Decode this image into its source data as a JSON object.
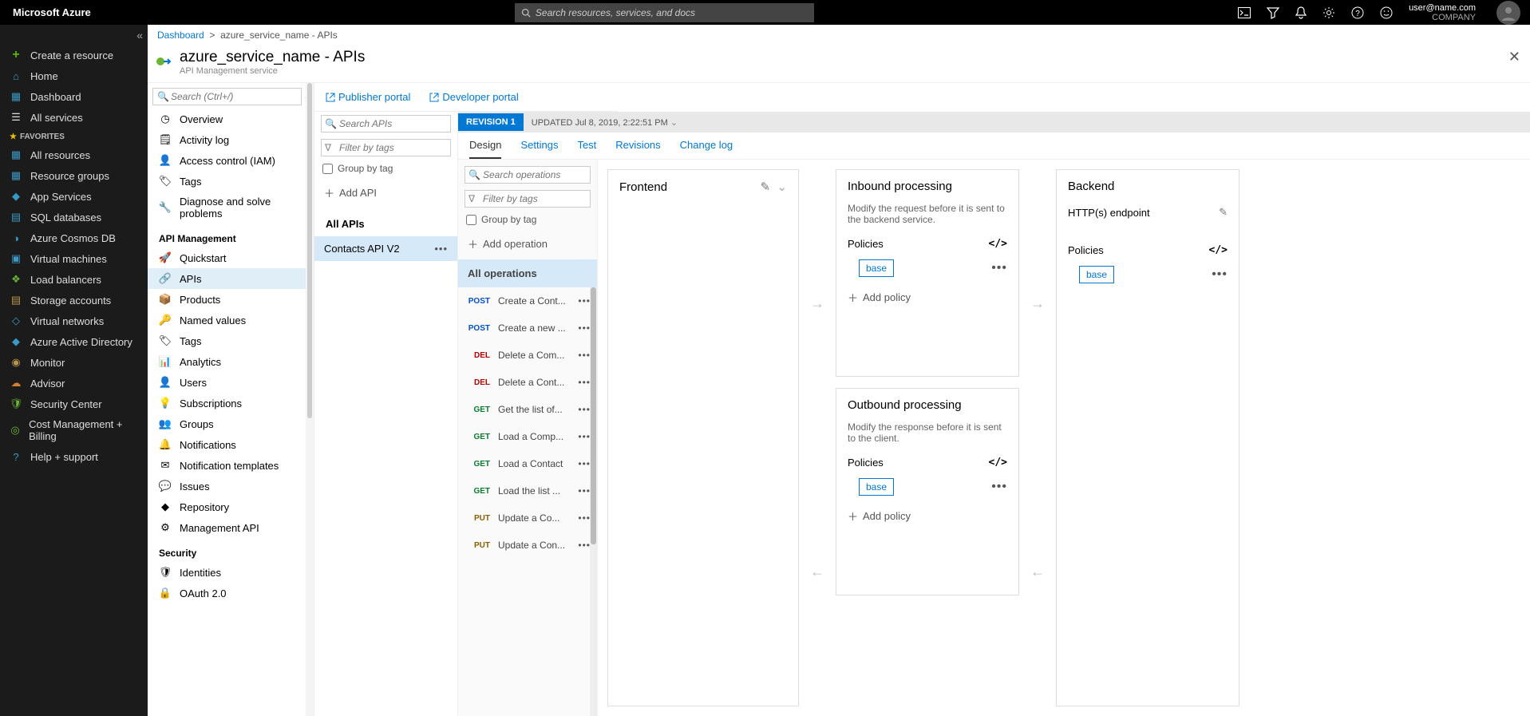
{
  "topbar": {
    "brand": "Microsoft Azure",
    "search_placeholder": "Search resources, services, and docs",
    "user_email": "user@name.com",
    "user_company": "COMPANY"
  },
  "leftnav": {
    "create": "Create a resource",
    "home": "Home",
    "dashboard": "Dashboard",
    "all_services": "All services",
    "favorites_label": "FAVORITES",
    "items": [
      "All resources",
      "Resource groups",
      "App Services",
      "SQL databases",
      "Azure Cosmos DB",
      "Virtual machines",
      "Load balancers",
      "Storage accounts",
      "Virtual networks",
      "Azure Active Directory",
      "Monitor",
      "Advisor",
      "Security Center",
      "Cost Management + Billing",
      "Help + support"
    ]
  },
  "breadcrumb": {
    "root": "Dashboard",
    "current": "azure_service_name - APIs"
  },
  "page": {
    "title": "azure_service_name - APIs",
    "subtitle": "API Management service"
  },
  "blade": {
    "search_placeholder": "Search (Ctrl+/)",
    "top_items": [
      "Overview",
      "Activity log",
      "Access control (IAM)",
      "Tags",
      "Diagnose and solve problems"
    ],
    "section1": "API Management",
    "mgmt_items": [
      "Quickstart",
      "APIs",
      "Products",
      "Named values",
      "Tags",
      "Analytics",
      "Users",
      "Subscriptions",
      "Groups",
      "Notifications",
      "Notification templates",
      "Issues",
      "Repository",
      "Management API"
    ],
    "section2": "Security",
    "sec_items": [
      "Identities",
      "OAuth 2.0"
    ]
  },
  "portals": {
    "publisher": "Publisher portal",
    "developer": "Developer portal"
  },
  "apis": {
    "search_placeholder": "Search APIs",
    "filter_placeholder": "Filter by tags",
    "group_by_tag": "Group by tag",
    "add_api": "Add API",
    "all_apis": "All APIs",
    "selected": "Contacts API V2"
  },
  "revision": {
    "label": "REVISION 1",
    "updated_prefix": "UPDATED",
    "updated_value": "Jul 8, 2019, 2:22:51 PM"
  },
  "tabs": [
    "Design",
    "Settings",
    "Test",
    "Revisions",
    "Change log"
  ],
  "ops": {
    "search_placeholder": "Search operations",
    "filter_placeholder": "Filter by tags",
    "group_by_tag": "Group by tag",
    "add_operation": "Add operation",
    "all_operations": "All operations",
    "list": [
      {
        "verb": "POST",
        "name": "Create a Cont..."
      },
      {
        "verb": "POST",
        "name": "Create a new ..."
      },
      {
        "verb": "DEL",
        "name": "Delete a Com..."
      },
      {
        "verb": "DEL",
        "name": "Delete a Cont..."
      },
      {
        "verb": "GET",
        "name": "Get the list of..."
      },
      {
        "verb": "GET",
        "name": "Load a Comp..."
      },
      {
        "verb": "GET",
        "name": "Load a Contact"
      },
      {
        "verb": "GET",
        "name": "Load the list ..."
      },
      {
        "verb": "PUT",
        "name": "Update a Co..."
      },
      {
        "verb": "PUT",
        "name": "Update a Con..."
      }
    ]
  },
  "panels": {
    "frontend": "Frontend",
    "inbound_title": "Inbound processing",
    "inbound_sub": "Modify the request before it is sent to the backend service.",
    "outbound_title": "Outbound processing",
    "outbound_sub": "Modify the response before it is sent to the client.",
    "backend_title": "Backend",
    "backend_sub": "HTTP(s) endpoint",
    "policies": "Policies",
    "base": "base",
    "add_policy": "Add policy"
  }
}
